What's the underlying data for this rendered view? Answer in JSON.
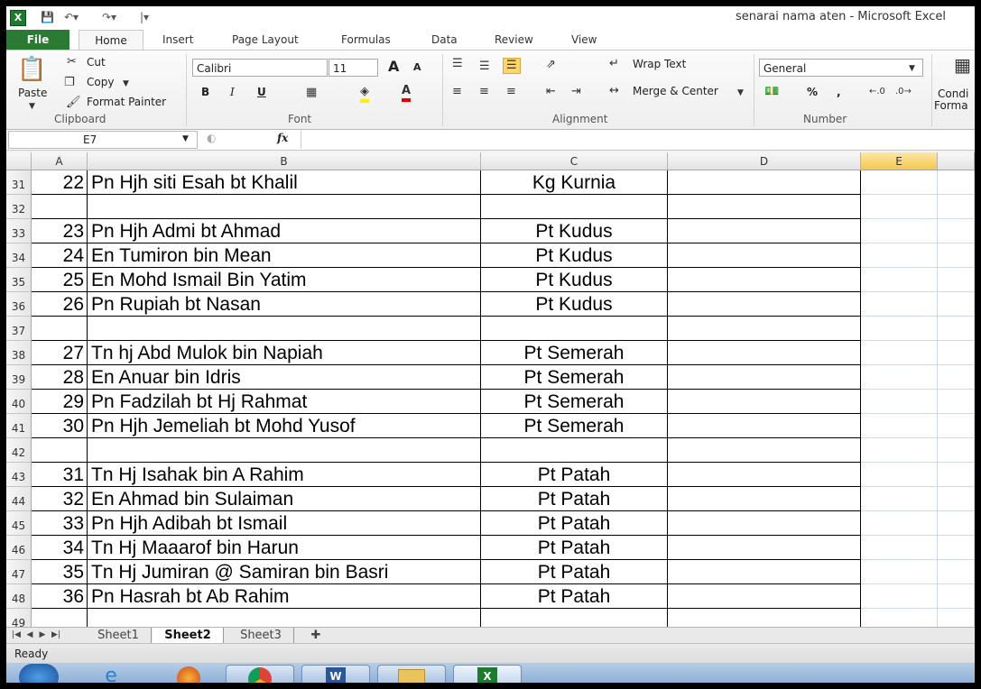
{
  "window": {
    "title": "senarai nama aten  -  Microsoft Excel"
  },
  "tabs": [
    "File",
    "Home",
    "Insert",
    "Page Layout",
    "Formulas",
    "Data",
    "Review",
    "View"
  ],
  "ribbon": {
    "clipboard": {
      "paste": "Paste",
      "cut": "Cut",
      "copy": "Copy",
      "format_painter": "Format Painter",
      "label": "Clipboard"
    },
    "font": {
      "name": "Calibri",
      "size": "11",
      "label": "Font",
      "grow": "A",
      "shrink": "A",
      "bold": "B",
      "italic": "I",
      "underline": "U"
    },
    "alignment": {
      "wrap": "Wrap Text",
      "merge": "Merge & Center",
      "label": "Alignment"
    },
    "number": {
      "format": "General",
      "percent": "%",
      "comma": ",",
      "label": "Number"
    },
    "styles": {
      "cond": "Condi",
      "format": "Forma"
    }
  },
  "formula_bar": {
    "cell_ref": "E7",
    "fx": "fx",
    "value": ""
  },
  "columns": [
    "A",
    "B",
    "C",
    "D",
    "E"
  ],
  "rows": [
    {
      "row": "31",
      "num": "22",
      "name": "Pn Hjh siti Esah bt Khalil",
      "place": "Kg Kurnia"
    },
    {
      "row": "32",
      "num": "",
      "name": "",
      "place": ""
    },
    {
      "row": "33",
      "num": "23",
      "name": "Pn Hjh Admi bt Ahmad",
      "place": "Pt Kudus"
    },
    {
      "row": "34",
      "num": "24",
      "name": "En Tumiron bin Mean",
      "place": "Pt Kudus"
    },
    {
      "row": "35",
      "num": "25",
      "name": "En Mohd Ismail Bin Yatim",
      "place": "Pt Kudus"
    },
    {
      "row": "36",
      "num": "26",
      "name": "Pn Rupiah bt Nasan",
      "place": "Pt Kudus"
    },
    {
      "row": "37",
      "num": "",
      "name": "",
      "place": ""
    },
    {
      "row": "38",
      "num": "27",
      "name": "Tn hj Abd Mulok bin Napiah",
      "place": "Pt Semerah"
    },
    {
      "row": "39",
      "num": "28",
      "name": "En Anuar bin Idris",
      "place": "Pt Semerah"
    },
    {
      "row": "40",
      "num": "29",
      "name": "Pn Fadzilah bt Hj Rahmat",
      "place": "Pt Semerah"
    },
    {
      "row": "41",
      "num": "30",
      "name": "Pn Hjh Jemeliah bt Mohd Yusof",
      "place": "Pt Semerah"
    },
    {
      "row": "42",
      "num": "",
      "name": "",
      "place": ""
    },
    {
      "row": "43",
      "num": "31",
      "name": "Tn Hj Isahak bin A Rahim",
      "place": "Pt Patah"
    },
    {
      "row": "44",
      "num": "32",
      "name": "En Ahmad bin Sulaiman",
      "place": "Pt Patah"
    },
    {
      "row": "45",
      "num": "33",
      "name": "Pn Hjh Adibah bt Ismail",
      "place": "Pt Patah"
    },
    {
      "row": "46",
      "num": "34",
      "name": "Tn Hj Maaarof bin Harun",
      "place": "Pt Patah"
    },
    {
      "row": "47",
      "num": "35",
      "name": "Tn Hj Jumiran @ Samiran bin Basri",
      "place": "Pt Patah"
    },
    {
      "row": "48",
      "num": "36",
      "name": "Pn Hasrah bt Ab Rahim",
      "place": "Pt Patah"
    },
    {
      "row": "49",
      "num": "",
      "name": "",
      "place": ""
    }
  ],
  "sheets": [
    "Sheet1",
    "Sheet2",
    "Sheet3"
  ],
  "active_sheet": "Sheet2",
  "status": "Ready",
  "colors": {
    "file_tab": "#2b7a34",
    "selected_col": "#f9d97a"
  }
}
